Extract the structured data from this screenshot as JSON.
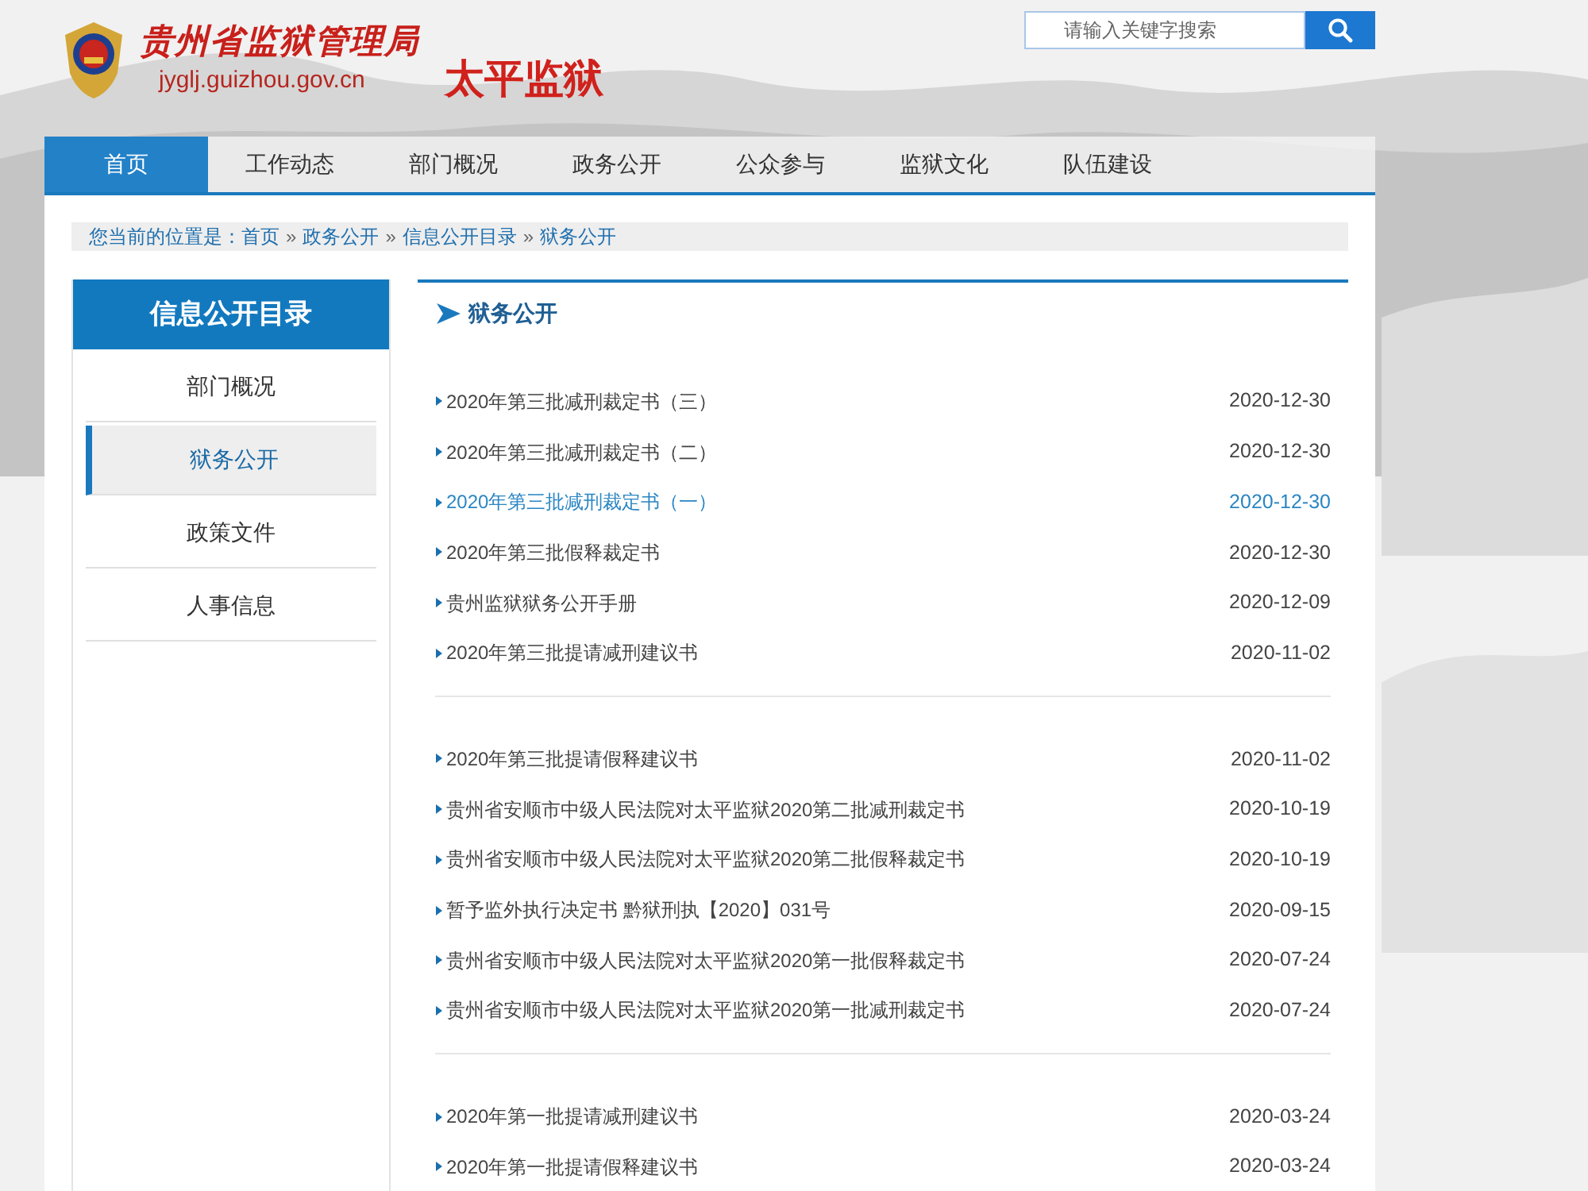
{
  "header": {
    "agency_name": "贵州省监狱管理局",
    "site_url": "jyglj.guizhou.gov.cn",
    "site_title": "太平监狱"
  },
  "search": {
    "placeholder": "请输入关键字搜索"
  },
  "nav": [
    {
      "label": "首页",
      "selected": true
    },
    {
      "label": "工作动态",
      "selected": false
    },
    {
      "label": "部门概况",
      "selected": false
    },
    {
      "label": "政务公开",
      "selected": false
    },
    {
      "label": "公众参与",
      "selected": false
    },
    {
      "label": "监狱文化",
      "selected": false
    },
    {
      "label": "队伍建设",
      "selected": false
    }
  ],
  "breadcrumb": {
    "prefix": "您当前的位置是：",
    "links": [
      "首页",
      "政务公开",
      "信息公开目录",
      "狱务公开"
    ],
    "separator": "»"
  },
  "sidebar": {
    "title": "信息公开目录",
    "items": [
      {
        "label": "部门概况",
        "selected": false
      },
      {
        "label": "狱务公开",
        "selected": true
      },
      {
        "label": "政策文件",
        "selected": false
      },
      {
        "label": "人事信息",
        "selected": false
      }
    ]
  },
  "content": {
    "title": "狱务公开",
    "groups": [
      [
        {
          "title": "2020年第三批减刑裁定书（三）",
          "date": "2020-12-30",
          "selected": false
        },
        {
          "title": "2020年第三批减刑裁定书（二）",
          "date": "2020-12-30",
          "selected": false
        },
        {
          "title": "2020年第三批减刑裁定书（一）",
          "date": "2020-12-30",
          "selected": true
        },
        {
          "title": "2020年第三批假释裁定书",
          "date": "2020-12-30",
          "selected": false
        },
        {
          "title": "贵州监狱狱务公开手册",
          "date": "2020-12-09",
          "selected": false
        },
        {
          "title": "2020年第三批提请减刑建议书",
          "date": "2020-11-02",
          "selected": false
        }
      ],
      [
        {
          "title": "2020年第三批提请假释建议书",
          "date": "2020-11-02",
          "selected": false
        },
        {
          "title": "贵州省安顺市中级人民法院对太平监狱2020第二批减刑裁定书",
          "date": "2020-10-19",
          "selected": false
        },
        {
          "title": "贵州省安顺市中级人民法院对太平监狱2020第二批假释裁定书",
          "date": "2020-10-19",
          "selected": false
        },
        {
          "title": "暂予监外执行决定书 黔狱刑执【2020】031号",
          "date": "2020-09-15",
          "selected": false
        },
        {
          "title": "贵州省安顺市中级人民法院对太平监狱2020第一批假释裁定书",
          "date": "2020-07-24",
          "selected": false
        },
        {
          "title": "贵州省安顺市中级人民法院对太平监狱2020第一批减刑裁定书",
          "date": "2020-07-24",
          "selected": false
        }
      ],
      [
        {
          "title": "2020年第一批提请减刑建议书",
          "date": "2020-03-24",
          "selected": false
        },
        {
          "title": "2020年第一批提请假释建议书",
          "date": "2020-03-24",
          "selected": false
        }
      ]
    ]
  }
}
